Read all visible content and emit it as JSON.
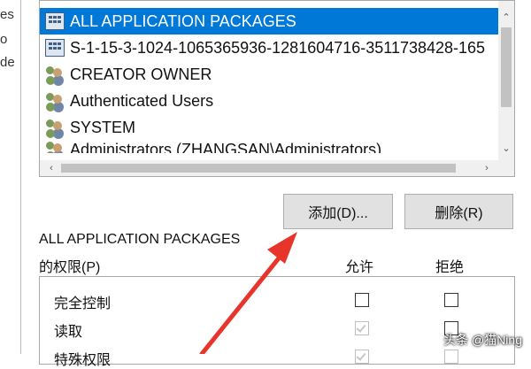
{
  "principals": {
    "items": [
      {
        "label": "ALL APPLICATION PACKAGES",
        "icon": "package-icon",
        "selected": true
      },
      {
        "label": "S-1-15-3-1024-1065365936-1281604716-3511738428-165",
        "icon": "package-icon",
        "selected": false
      },
      {
        "label": "CREATOR OWNER",
        "icon": "users-icon",
        "selected": false
      },
      {
        "label": "Authenticated Users",
        "icon": "users-icon",
        "selected": false
      },
      {
        "label": "SYSTEM",
        "icon": "users-icon",
        "selected": false
      },
      {
        "label": "Administrators (ZHANGSAN\\Administrators)",
        "icon": "users-icon",
        "selected": false
      }
    ]
  },
  "buttons": {
    "add": "添加(D)...",
    "remove": "删除(R)"
  },
  "permissions": {
    "title": "ALL APPLICATION PACKAGES",
    "subtitle": "的权限(P)",
    "col_allow": "允许",
    "col_deny": "拒绝",
    "rows": [
      {
        "name": "完全控制",
        "allow": false,
        "deny": false
      },
      {
        "name": "读取",
        "allow": true,
        "deny": false
      },
      {
        "name": "特殊权限",
        "allow": true,
        "deny": false
      }
    ]
  },
  "watermark": "头条 @猫Ning",
  "colors": {
    "selection": "#0078d7",
    "arrow": "#e8352b"
  }
}
